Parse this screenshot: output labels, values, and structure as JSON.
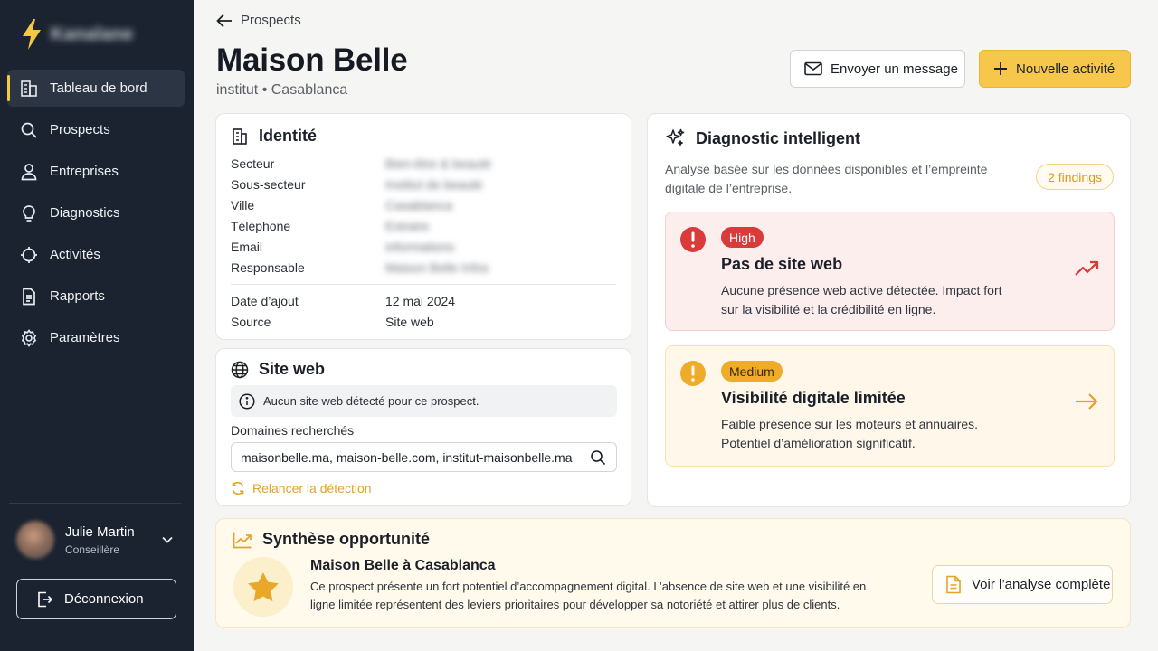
{
  "sidebar": {
    "brand_name": "Kanalane",
    "items": [
      {
        "label": "Tableau de bord",
        "icon": "building-icon",
        "active": true
      },
      {
        "label": "Prospects",
        "icon": "search-icon"
      },
      {
        "label": "Entreprises",
        "icon": "user-icon"
      },
      {
        "label": "Diagnostics",
        "icon": "lightbulb-icon"
      },
      {
        "label": "Activités",
        "icon": "activity-icon"
      },
      {
        "label": "Rapports",
        "icon": "report-icon"
      },
      {
        "label": "Paramètres",
        "icon": "gear-icon"
      }
    ],
    "user": {
      "name": "Julie Martin",
      "role": "Conseillère"
    },
    "logout_label": "Déconnexion"
  },
  "header": {
    "back_label": "Prospects",
    "title": "Maison Belle",
    "subtitle": "institut • Casablanca",
    "message_button": "Envoyer un message",
    "new_activity_button": "Nouvelle activité"
  },
  "identity": {
    "title": "Identité",
    "fields": [
      {
        "label": "Secteur",
        "value": "Bien-être & beauté"
      },
      {
        "label": "Sous-secteur",
        "value": "Institut de beauté"
      },
      {
        "label": "Ville",
        "value": "Casablanca"
      },
      {
        "label": "Téléphone",
        "value": "Extraire"
      },
      {
        "label": "Email",
        "value": "informations"
      },
      {
        "label": "Responsable",
        "value": "Maison Belle Infos"
      }
    ],
    "meta": [
      {
        "label": "Date d’ajout",
        "value": "12 mai 2024"
      },
      {
        "label": "Source",
        "value": "Site web"
      }
    ]
  },
  "website": {
    "title": "Site web",
    "info": "Aucun site web détecté pour ce prospect.",
    "domains_label": "Domaines recherchés",
    "domains_value": "maisonbelle.ma, maison-belle.com, institut-maisonbelle.ma",
    "redetect_label": "Relancer la détection"
  },
  "diagnostic": {
    "title": "Diagnostic intelligent",
    "description": "Analyse basée sur les données disponibles et l’empreinte digitale de l’entreprise.",
    "findings_count": "2 findings",
    "findings": [
      {
        "severity": "High",
        "title": "Pas de site web",
        "description": "Aucune présence web active détectée. Impact fort sur la visibilité et la crédibilité en ligne.",
        "color": "#d93a3a"
      },
      {
        "severity": "Medium",
        "title": "Visibilité digitale limitée",
        "description": "Faible présence sur les moteurs et annuaires. Potentiel d’amélioration significatif.",
        "color": "#efab2a"
      }
    ]
  },
  "synthesis": {
    "title": "Synthèse opportunité",
    "heading": "Maison Belle à Casablanca",
    "text": "Ce prospect présente un fort potentiel d’accompagnement digital. L’absence de site web et une visibilité en ligne limitée représentent des leviers prioritaires pour développer sa notoriété et attirer plus de clients.",
    "button": "Voir l’analyse complète"
  },
  "colors": {
    "accent": "#f6c74a",
    "sidebar": "#1b2330",
    "high": "#d93a3a",
    "medium": "#efab2a"
  }
}
